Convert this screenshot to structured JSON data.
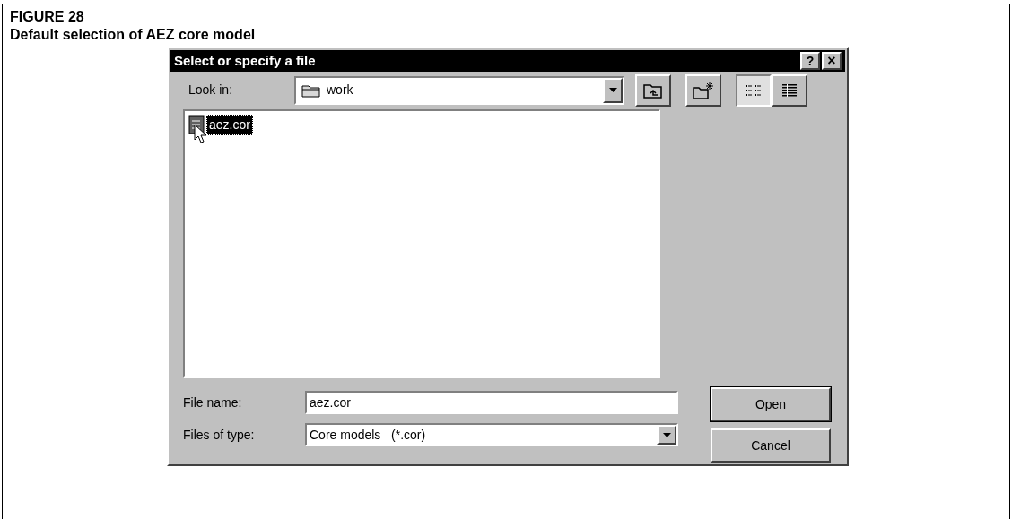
{
  "figure": {
    "number": "FIGURE 28",
    "caption": "Default selection of AEZ core model"
  },
  "dialog": {
    "title": "Select or specify a file",
    "help_button": "?",
    "close_button": "×",
    "look_in": {
      "label": "Look in:",
      "value": "work"
    },
    "view_modes": [
      {
        "kind": "list",
        "selected": true
      },
      {
        "kind": "details",
        "selected": false
      }
    ],
    "files": [
      {
        "name": "aez.cor",
        "selected": true
      }
    ],
    "file_name": {
      "label": "File name:",
      "value": "aez.cor"
    },
    "files_of_type": {
      "label": "Files of type:",
      "value": "Core models   (*.cor)"
    },
    "buttons": [
      {
        "label": "Open",
        "default": true
      },
      {
        "label": "Cancel",
        "default": false
      }
    ]
  }
}
